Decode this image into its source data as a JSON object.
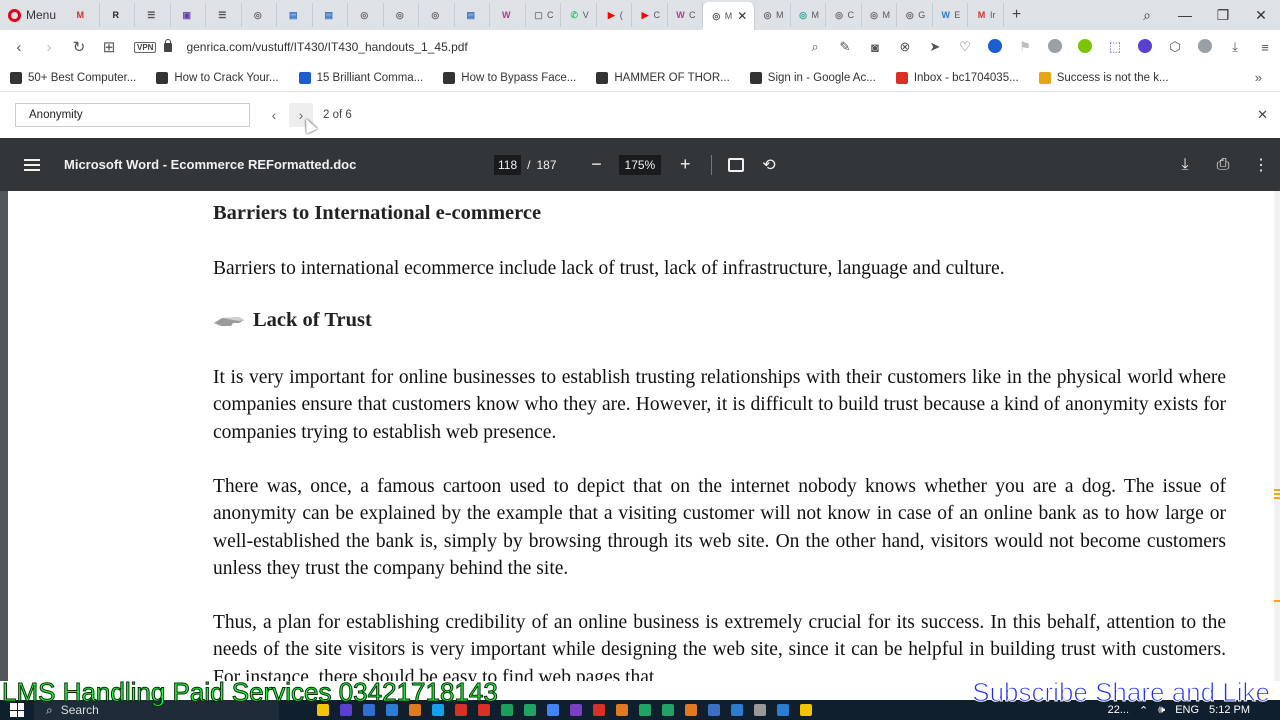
{
  "browser": {
    "menu_label": "Menu",
    "tabs": [
      {
        "fav": "M",
        "color": "#d93025",
        "label": ""
      },
      {
        "fav": "R",
        "color": "#222222",
        "label": ""
      },
      {
        "fav": "☰",
        "color": "#555555",
        "label": ""
      },
      {
        "fav": "▣",
        "color": "#6a3fb5",
        "label": ""
      },
      {
        "fav": "☰",
        "color": "#555555",
        "label": ""
      },
      {
        "fav": "◎",
        "color": "#666666",
        "label": ""
      },
      {
        "fav": "▤",
        "color": "#3a6fc4",
        "label": ""
      },
      {
        "fav": "▤",
        "color": "#3a6fc4",
        "label": ""
      },
      {
        "fav": "◎",
        "color": "#666666",
        "label": ""
      },
      {
        "fav": "◎",
        "color": "#666666",
        "label": ""
      },
      {
        "fav": "◎",
        "color": "#666666",
        "label": ""
      },
      {
        "fav": "▤",
        "color": "#3a6fc4",
        "label": ""
      },
      {
        "fav": "W",
        "color": "#b23a8f",
        "label": ""
      },
      {
        "fav": "▢",
        "color": "#777777",
        "label": "C"
      },
      {
        "fav": "✆",
        "color": "#25d366",
        "label": "V"
      },
      {
        "fav": "▶",
        "color": "#ff0000",
        "label": "("
      },
      {
        "fav": "▶",
        "color": "#ff0000",
        "label": "C"
      },
      {
        "fav": "W",
        "color": "#b23a8f",
        "label": "C"
      }
    ],
    "active_tab": {
      "fav": "◎",
      "label": "M",
      "close": "✕"
    },
    "tabs_after": [
      {
        "fav": "◎",
        "color": "#666666",
        "label": "M"
      },
      {
        "fav": "◎",
        "color": "#2aa198",
        "label": "M"
      },
      {
        "fav": "◎",
        "color": "#666666",
        "label": "C"
      },
      {
        "fav": "◎",
        "color": "#666666",
        "label": "M"
      },
      {
        "fav": "◎",
        "color": "#666666",
        "label": "G"
      },
      {
        "fav": "W",
        "color": "#2b7cd3",
        "label": "E"
      },
      {
        "fav": "M",
        "color": "#d93025",
        "label": "Ir"
      }
    ],
    "new_tab": "+",
    "url": "genrica.com/vustuff/IT430/IT430_handouts_1_45.pdf",
    "vpn": "VPN",
    "bookmarks": [
      {
        "label": "50+ Best Computer...",
        "color": "#333333"
      },
      {
        "label": "How to Crack Your...",
        "color": "#333333"
      },
      {
        "label": "15 Brilliant Comma...",
        "color": "#1a5fd1"
      },
      {
        "label": "How to Bypass Face...",
        "color": "#333333"
      },
      {
        "label": "HAMMER OF THOR...",
        "color": "#333333"
      },
      {
        "label": "Sign in - Google Ac...",
        "color": "#333333"
      },
      {
        "label": "Inbox - bc1704035...",
        "color": "#d93025"
      },
      {
        "label": "Success is not the k...",
        "color": "#e8a317"
      }
    ],
    "more_bookmarks": "»"
  },
  "find": {
    "value": "Anonymity",
    "count": "2 of 6",
    "prev": "‹",
    "next": "›",
    "close": "✕"
  },
  "pdf": {
    "title": "Microsoft Word - Ecommerce REFormatted.doc",
    "page_current": "118",
    "page_sep": "/",
    "page_total": "187",
    "zoom": "175%",
    "zoom_out": "−",
    "zoom_in": "+"
  },
  "document": {
    "heading": "Barriers to International e-commerce",
    "intro": "Barriers to international ecommerce include lack of trust, lack of infrastructure, language and culture.",
    "subheading": "Lack of Trust",
    "p1": "It is very important for online businesses to establish trusting relationships with their customers like in the physical world where companies ensure that customers know who they are. However, it is difficult to build trust because a kind of anonymity exists for companies trying to establish web presence.",
    "p2": "There was, once, a famous cartoon used to depict that on the internet nobody knows whether you are a dog. The issue of anonymity can be explained by the example that a visiting customer will not know in case of an online bank as to how large or well-established the bank is, simply by browsing through its web site. On the other hand, visitors would not become customers unless they trust the company behind the site.",
    "p3": "Thus, a plan for establishing credibility of an online business is extremely crucial for its success. In this behalf, attention to the needs of the site visitors is very important while designing the web site, since it can be helpful in building trust with customers. For instance, there should be easy to find web pages that"
  },
  "overlay": {
    "left_caption": "LMS Handling Paid Services 03421718143",
    "right_caption": "Subscribe Share and Like"
  },
  "taskbar": {
    "search": "Search",
    "apps": [
      "#f5c400",
      "#5b3fd1",
      "#2f6fd6",
      "#2b7cd3",
      "#e07a20",
      "#1aa0e8",
      "#d93025",
      "#d93025",
      "#1aa05a",
      "#21a366",
      "#4285f4",
      "#7b3fc4",
      "#d93025",
      "#e07a20",
      "#21a366",
      "#21a366",
      "#e07a20",
      "#3a6fc4",
      "#2b7cd3",
      "#999999",
      "#2b7cd3",
      "#f5c400"
    ],
    "tray_text": "22...",
    "language": "ENG",
    "time": "5:12 PM"
  }
}
